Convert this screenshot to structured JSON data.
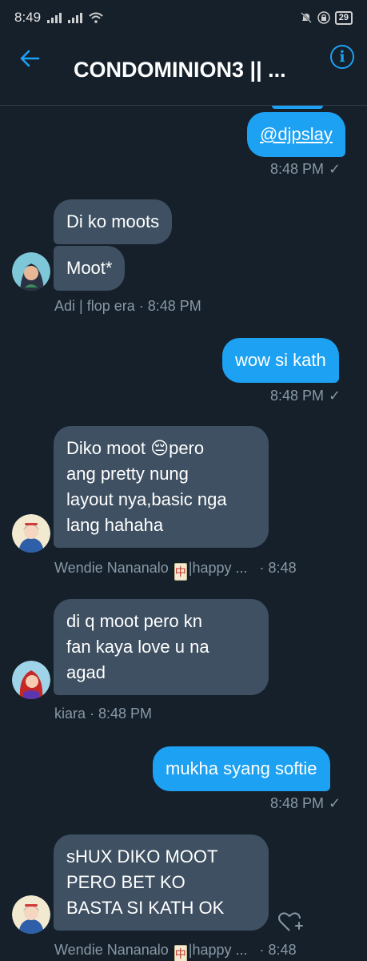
{
  "status_bar": {
    "time": "8:49",
    "battery": "29"
  },
  "header": {
    "title": "CONDOMINION3 || ...",
    "back_icon": "arrow-left-icon",
    "info_icon": "info-icon"
  },
  "colors": {
    "background": "#15202b",
    "accent": "#1da1f2",
    "incoming_bubble": "#3e5062",
    "meta_text": "#8899a6"
  },
  "messages": [
    {
      "direction": "out",
      "text": "@djpslay",
      "time": "8:48 PM"
    },
    {
      "direction": "in",
      "texts": [
        "Di ko moots",
        "Moot*"
      ],
      "sender_line": "Adi | flop era · 8:48 PM"
    },
    {
      "direction": "out",
      "text": "wow si kath",
      "time": "8:48 PM"
    },
    {
      "direction": "in",
      "lines": [
        "Diko moot 😔pero",
        "ang pretty nung",
        "layout nya,basic nga",
        "lang hahaha"
      ],
      "sender": "Wendie Nananalo",
      "sender_suffix": "|happy ...",
      "sender_time": "· 8:48"
    },
    {
      "direction": "in",
      "lines": [
        "di q moot pero kn",
        "fan kaya love u na",
        "agad"
      ],
      "sender_line": "kiara · 8:48 PM"
    },
    {
      "direction": "out",
      "text": "mukha syang softie",
      "time": "8:48 PM"
    },
    {
      "direction": "in",
      "lines": [
        "sHUX DIKO MOOT",
        "PERO BET KO",
        "BASTA SI KATH OK"
      ],
      "sender": "Wendie Nananalo",
      "sender_suffix": "|happy ...",
      "sender_time": "· 8:48"
    }
  ]
}
